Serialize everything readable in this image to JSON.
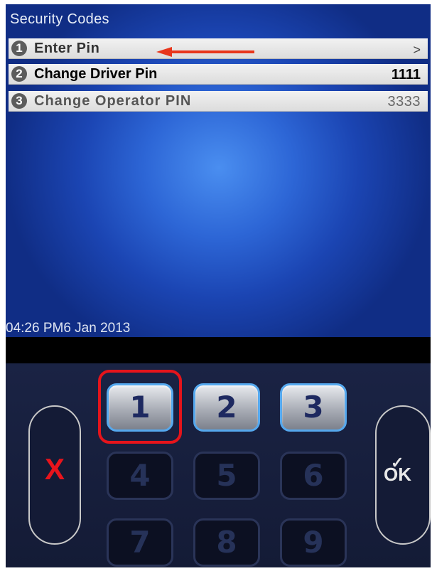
{
  "screen": {
    "title": "Security Codes",
    "timestamp": "04:26 PM6 Jan 2013"
  },
  "menu": {
    "items": [
      {
        "number": "1",
        "label": "Enter Pin",
        "value": ">"
      },
      {
        "number": "2",
        "label": "Change Driver Pin",
        "value": "1111"
      },
      {
        "number": "3",
        "label": "Change Operator PIN",
        "value": "3333"
      }
    ]
  },
  "keypad": {
    "keys": [
      "1",
      "2",
      "3",
      "4",
      "5",
      "6",
      "7",
      "8",
      "9"
    ],
    "cancel_label": "X",
    "ok_label": "OK",
    "ok_check": "✓"
  },
  "colors": {
    "annotation_red": "#e5141b",
    "screen_blue": "#2d66d6",
    "active_key_border": "#55a8ee"
  },
  "icons": {
    "arrow": "left-arrow-icon",
    "cancel": "x-icon",
    "ok": "checkmark-icon"
  }
}
